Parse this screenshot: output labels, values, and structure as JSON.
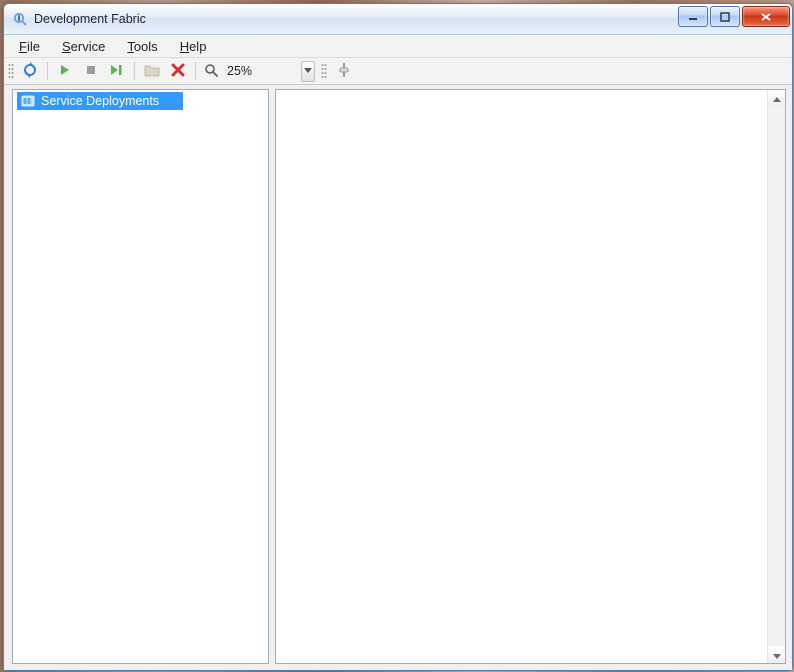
{
  "window": {
    "title": "Development Fabric"
  },
  "menubar": {
    "items": [
      {
        "label": "File",
        "accel_index": 0
      },
      {
        "label": "Service",
        "accel_index": 0
      },
      {
        "label": "Tools",
        "accel_index": 0
      },
      {
        "label": "Help",
        "accel_index": 0
      }
    ]
  },
  "toolbar": {
    "zoom_value": "25%"
  },
  "tree": {
    "root_label": "Service Deployments"
  }
}
